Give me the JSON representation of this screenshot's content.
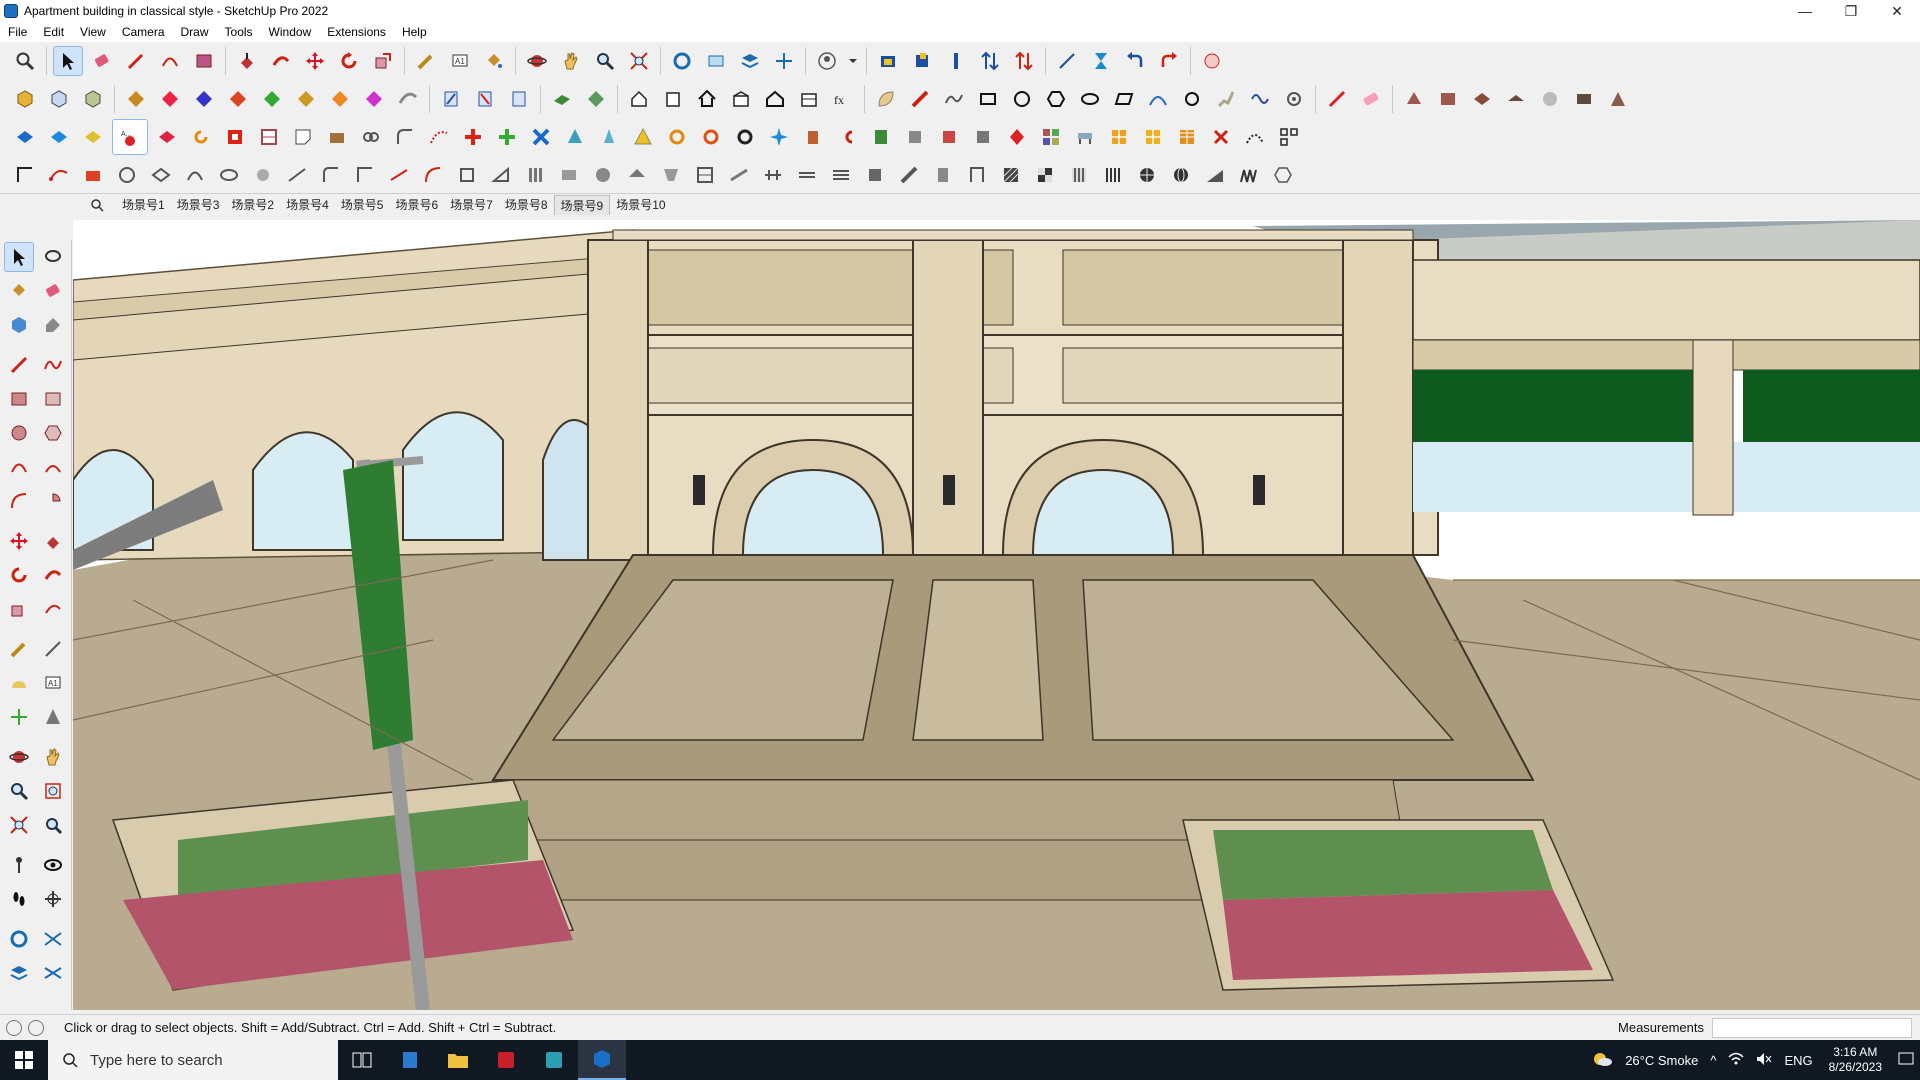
{
  "window": {
    "title": "Apartment building in classical style - SketchUp Pro 2022",
    "minimize_glyph": "—",
    "maximize_glyph": "❐",
    "close_glyph": "✕"
  },
  "menu": [
    "File",
    "Edit",
    "View",
    "Camera",
    "Draw",
    "Tools",
    "Window",
    "Extensions",
    "Help"
  ],
  "scenes": {
    "items": [
      "场景号1",
      "场景号3",
      "场景号2",
      "场景号4",
      "场景号5",
      "场景号6",
      "场景号7",
      "场景号8",
      "场景号9",
      "场景号10"
    ],
    "active_index": 8
  },
  "status": {
    "message": "Click or drag to select objects. Shift = Add/Subtract. Ctrl = Add. Shift + Ctrl = Subtract.",
    "measurements_label": "Measurements",
    "measurements_value": ""
  },
  "taskbar": {
    "search_placeholder": "Type here to search",
    "weather": "26°C  Smoke",
    "language": "ENG",
    "time": "3:16 AM",
    "date": "8/26/2023"
  },
  "colors": {
    "titlebar": "#ffffff",
    "toolbar_bg": "#f0f0f0",
    "taskbar": "#101822",
    "stone": "#e8dcc2",
    "paving": "#b9ab8f",
    "awning": "#0c5a1e",
    "sky": "#d8ecf4"
  }
}
